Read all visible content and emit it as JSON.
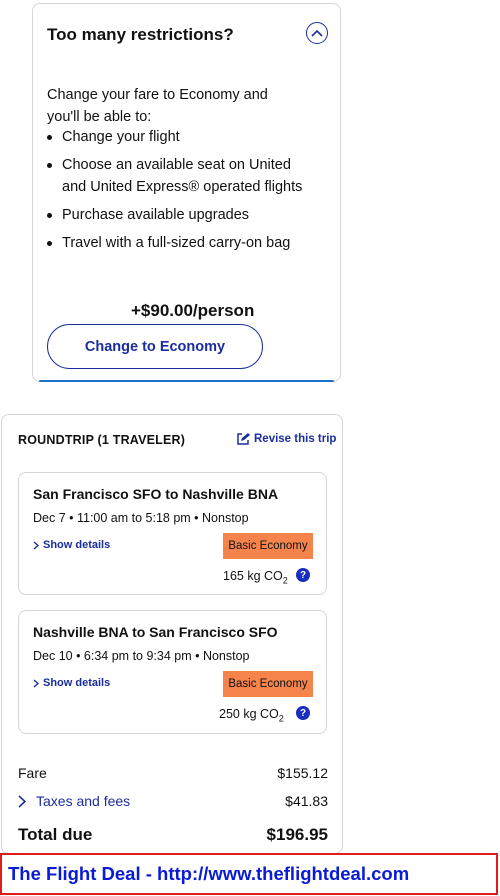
{
  "upsell": {
    "title": "Too many restrictions?",
    "intro": "Change your fare to Economy and you'll be able to:",
    "benefits": [
      "Change your flight",
      "Choose an available seat on United and United Express® operated flights",
      "Purchase available upgrades",
      "Travel with a full-sized carry-on bag"
    ],
    "price": "+$90.00/person",
    "button_label": "Change to Economy"
  },
  "trip": {
    "header": "ROUNDTRIP (1 TRAVELER)",
    "revise_label": "Revise this trip",
    "flights": [
      {
        "route": "San Francisco SFO to Nashville BNA",
        "times": "Dec 7 • 11:00 am to 5:18 pm • Nonstop",
        "details_label": "Show details",
        "fare_class": "Basic Economy",
        "co2_value": "165 kg",
        "co2_unit": "CO",
        "co2_sub": "2"
      },
      {
        "route": "Nashville BNA to San Francisco SFO",
        "times": "Dec 10 • 6:34 pm to 9:34 pm • Nonstop",
        "details_label": "Show details",
        "fare_class": "Basic Economy",
        "co2_value": "250 kg",
        "co2_unit": "CO",
        "co2_sub": "2"
      }
    ],
    "fare_label": "Fare",
    "fare_value": "$155.12",
    "taxes_label": "Taxes and fees",
    "taxes_value": "$41.83",
    "total_label": "Total due",
    "total_value": "$196.95"
  },
  "banner": {
    "text": "The Flight Deal - http://www.theflightdeal.com"
  },
  "colors": {
    "link": "#1b2d9e",
    "badge": "#f5844c",
    "banner_border": "#e21c1c",
    "banner_text": "#0a1bd8"
  }
}
